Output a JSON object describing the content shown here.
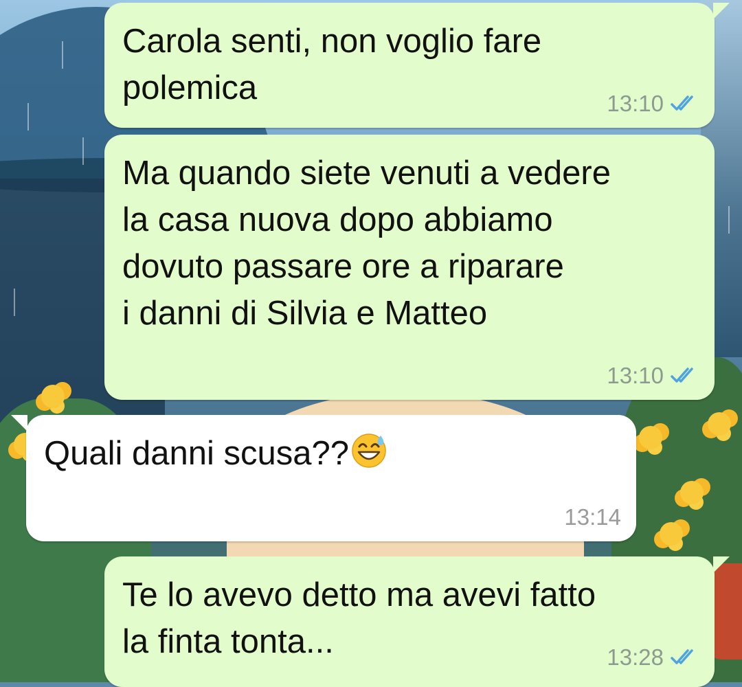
{
  "messages": [
    {
      "direction": "outgoing",
      "text": "Carola senti, non voglio fare\npolemica",
      "time": "13:10",
      "status": "read"
    },
    {
      "direction": "outgoing",
      "text": "Ma quando siete venuti a vedere\nla casa nuova dopo abbiamo\ndovuto passare ore a riparare\ni danni di Silvia e Matteo",
      "time": "13:10",
      "status": "read"
    },
    {
      "direction": "incoming",
      "text": "Quali danni scusa??",
      "emoji": "grinning-face-with-sweat",
      "time": "13:14"
    },
    {
      "direction": "outgoing",
      "text": "Te lo avevo detto ma avevi fatto\nla finta tonta...",
      "time": "13:28",
      "status": "read"
    }
  ],
  "colors": {
    "outgoing_bubble": "#e2fccb",
    "incoming_bubble": "#ffffff",
    "read_ticks": "#4fa3e0",
    "timestamp": "#8c9a90"
  },
  "icons": {
    "read_receipt": "double-check-icon",
    "emoji": "grinning-face-with-sweat-emoji"
  }
}
